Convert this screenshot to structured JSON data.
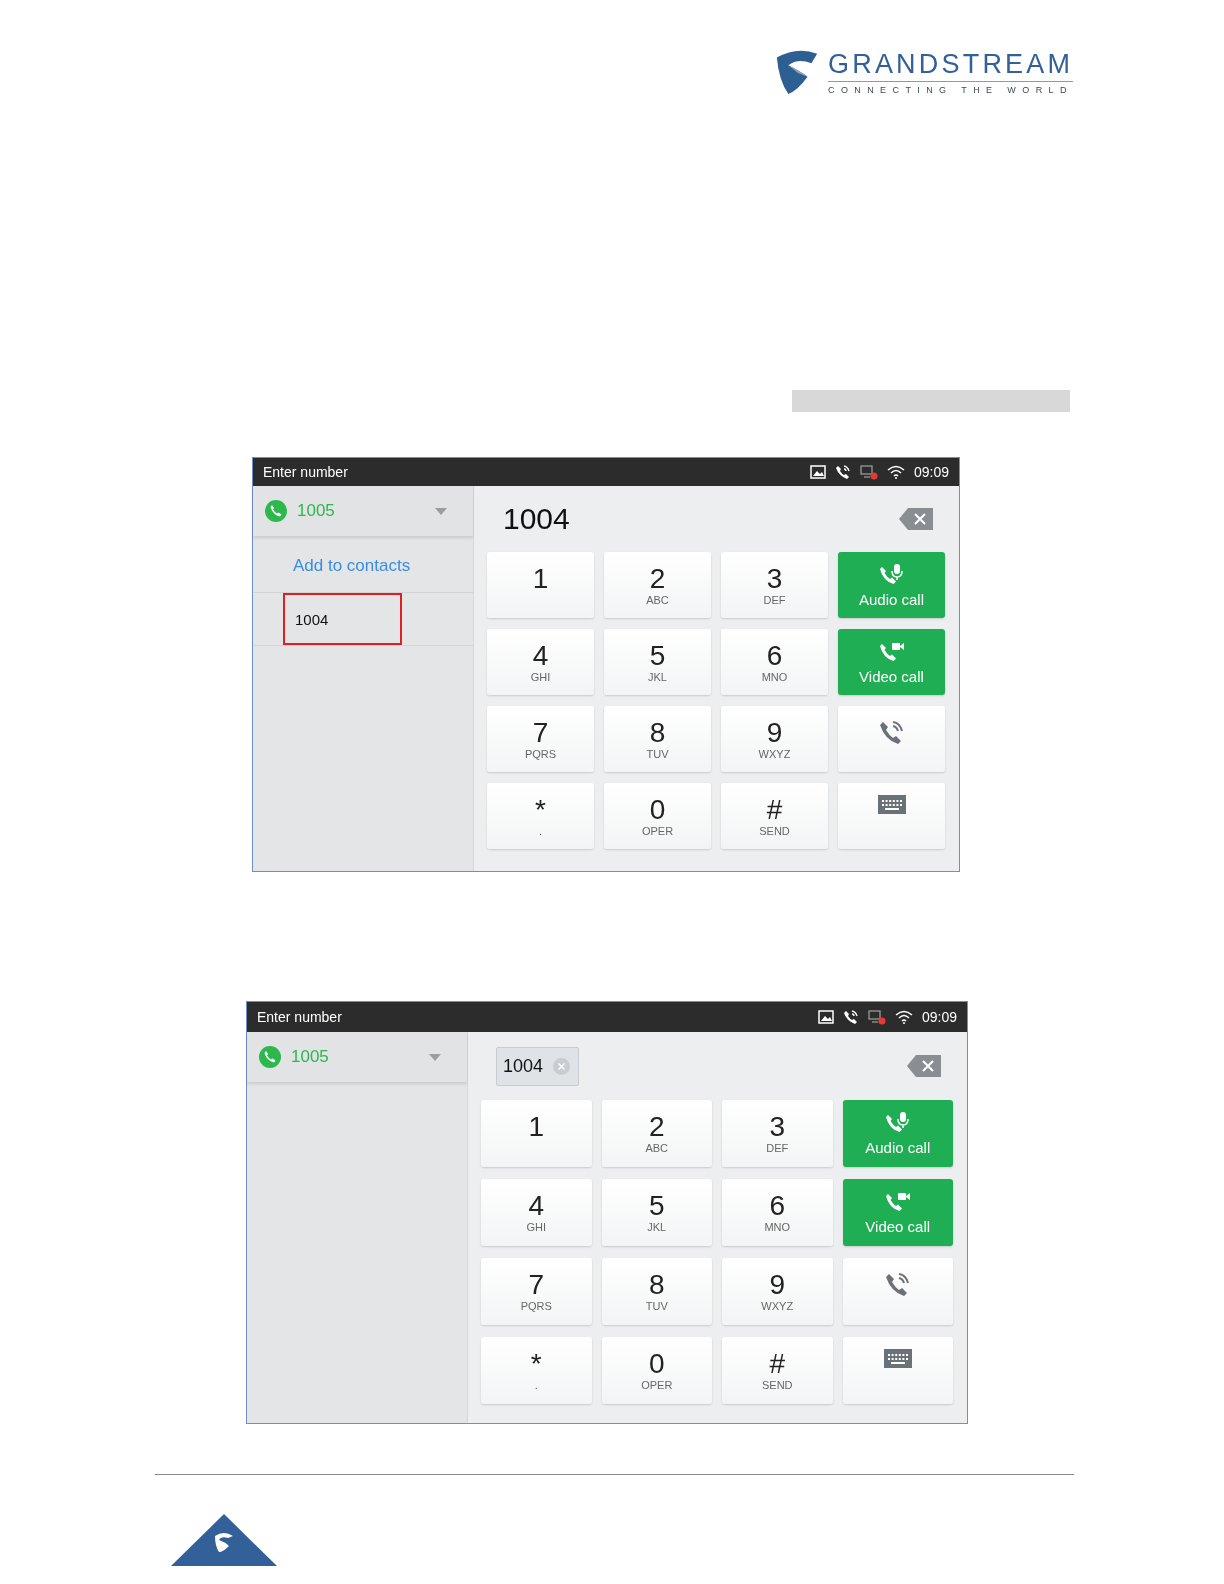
{
  "header": {
    "brand": "GRANDSTREAM",
    "tagline": "CONNECTING THE WORLD"
  },
  "screens": [
    {
      "title": "Enter number",
      "time": "09:09",
      "account": "1005",
      "entry": {
        "kind": "plain",
        "value": "1004"
      },
      "suggestions": [
        {
          "kind": "link",
          "label": "Add to contacts",
          "highlighted": false
        },
        {
          "kind": "number",
          "label": "1004",
          "highlighted": true
        }
      ],
      "keys": [
        {
          "digit": "1"
        },
        {
          "digit": "2",
          "letters": "ABC"
        },
        {
          "digit": "3",
          "letters": "DEF"
        },
        {
          "digit": "4",
          "letters": "GHI"
        },
        {
          "digit": "5",
          "letters": "JKL"
        },
        {
          "digit": "6",
          "letters": "MNO"
        },
        {
          "digit": "7",
          "letters": "PQRS"
        },
        {
          "digit": "8",
          "letters": "TUV"
        },
        {
          "digit": "9",
          "letters": "WXYZ"
        },
        {
          "digit": "*",
          "letters": "."
        },
        {
          "digit": "0",
          "letters": "OPER"
        },
        {
          "digit": "#",
          "letters": "SEND"
        }
      ],
      "actions": [
        {
          "kind": "audio",
          "label": "Audio call"
        },
        {
          "kind": "video",
          "label": "Video call"
        },
        {
          "kind": "redial"
        },
        {
          "kind": "keyboard"
        }
      ]
    },
    {
      "title": "Enter number",
      "time": "09:09",
      "account": "1005",
      "entry": {
        "kind": "chip",
        "value": "1004"
      },
      "keys": [
        {
          "digit": "1"
        },
        {
          "digit": "2",
          "letters": "ABC"
        },
        {
          "digit": "3",
          "letters": "DEF"
        },
        {
          "digit": "4",
          "letters": "GHI"
        },
        {
          "digit": "5",
          "letters": "JKL"
        },
        {
          "digit": "6",
          "letters": "MNO"
        },
        {
          "digit": "7",
          "letters": "PQRS"
        },
        {
          "digit": "8",
          "letters": "TUV"
        },
        {
          "digit": "9",
          "letters": "WXYZ"
        },
        {
          "digit": "*",
          "letters": "."
        },
        {
          "digit": "0",
          "letters": "OPER"
        },
        {
          "digit": "#",
          "letters": "SEND"
        }
      ],
      "actions": [
        {
          "kind": "audio",
          "label": "Audio call"
        },
        {
          "kind": "video",
          "label": "Video call"
        },
        {
          "kind": "redial"
        },
        {
          "kind": "keyboard"
        }
      ]
    }
  ]
}
